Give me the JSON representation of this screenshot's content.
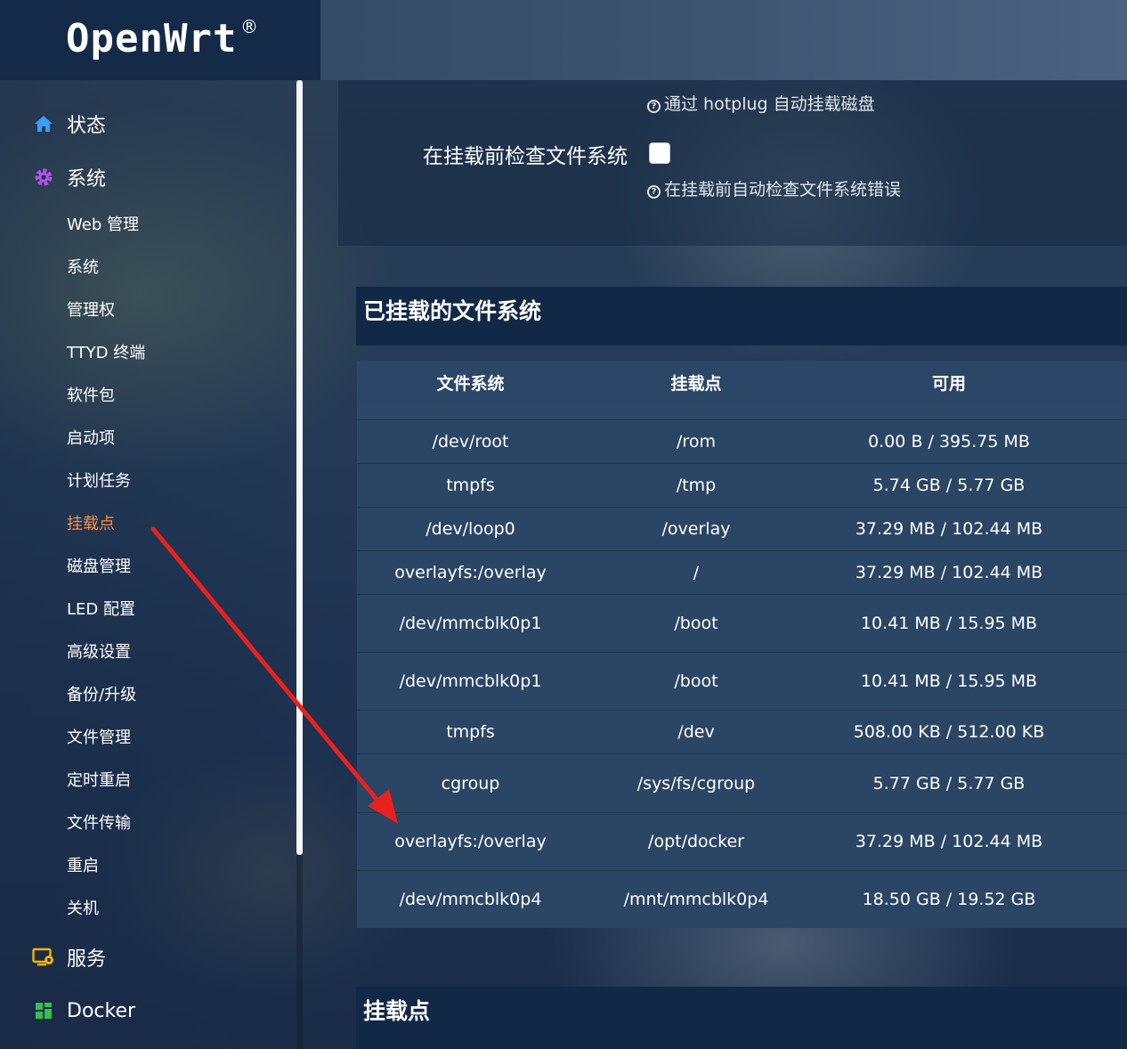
{
  "brand": {
    "name": "OpenWrt",
    "reg": "®"
  },
  "sidebar": {
    "main": [
      {
        "label": "状态",
        "icon": "home-icon"
      },
      {
        "label": "系统",
        "icon": "gear-icon"
      },
      {
        "label": "服务",
        "icon": "services-icon"
      },
      {
        "label": "Docker",
        "icon": "docker-grid-icon"
      }
    ],
    "sub": [
      {
        "label": "Web 管理"
      },
      {
        "label": "系统"
      },
      {
        "label": "管理权"
      },
      {
        "label": "TTYD 终端"
      },
      {
        "label": "软件包"
      },
      {
        "label": "启动项"
      },
      {
        "label": "计划任务"
      },
      {
        "label": "挂载点",
        "active": true
      },
      {
        "label": "磁盘管理"
      },
      {
        "label": "LED 配置"
      },
      {
        "label": "高级设置"
      },
      {
        "label": "备份/升级"
      },
      {
        "label": "文件管理"
      },
      {
        "label": "定时重启"
      },
      {
        "label": "文件传输"
      },
      {
        "label": "重启"
      },
      {
        "label": "关机"
      }
    ],
    "active_color": "#ff8c42"
  },
  "options": {
    "hotplug_hint": "通过 hotplug 自动挂载磁盘",
    "check_fs_label": "在挂载前检查文件系统",
    "check_fs_checked": false,
    "check_fs_hint": "在挂载前自动检查文件系统错误"
  },
  "mounted": {
    "title": "已挂载的文件系统",
    "columns": [
      "文件系统",
      "挂载点",
      "可用"
    ],
    "rows": [
      [
        "/dev/root",
        "/rom",
        "0.00 B / 395.75 MB"
      ],
      [
        "tmpfs",
        "/tmp",
        "5.74 GB / 5.77 GB"
      ],
      [
        "/dev/loop0",
        "/overlay",
        "37.29 MB / 102.44 MB"
      ],
      [
        "overlayfs:/overlay",
        "/",
        "37.29 MB / 102.44 MB"
      ],
      [
        "/dev/mmcblk0p1",
        "/boot",
        "10.41 MB / 15.95 MB"
      ],
      [
        "/dev/mmcblk0p1",
        "/boot",
        "10.41 MB / 15.95 MB"
      ],
      [
        "tmpfs",
        "/dev",
        "508.00 KB / 512.00 KB"
      ],
      [
        "cgroup",
        "/sys/fs/cgroup",
        "5.77 GB / 5.77 GB"
      ],
      [
        "overlayfs:/overlay",
        "/opt/docker",
        "37.29 MB / 102.44 MB"
      ],
      [
        "/dev/mmcblk0p4",
        "/mnt/mmcblk0p4",
        "18.50 GB / 19.52 GB"
      ]
    ]
  },
  "mountpoints": {
    "title": "挂载点"
  },
  "annotation": {
    "color": "#e8211f"
  }
}
